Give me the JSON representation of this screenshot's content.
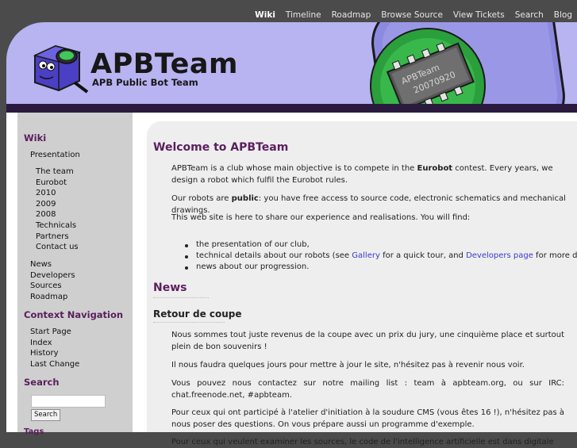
{
  "topnav": {
    "items": [
      "Wiki",
      "Timeline",
      "Roadmap",
      "Browse Source",
      "View Tickets",
      "Search",
      "Blog"
    ]
  },
  "header": {
    "title": "APBTeam",
    "subtitle": "APB Public Bot Team",
    "chip_text_line1": "APBTeam",
    "chip_text_line2": "20070920"
  },
  "sidebar": {
    "wiki_heading": "Wiki",
    "presentation": "Presentation",
    "presentation_sub": [
      "The team",
      "Eurobot",
      "2010",
      "2009",
      "2008",
      "Technicals",
      "Partners",
      "Contact us"
    ],
    "other_items": [
      "News",
      "Developers",
      "Sources",
      "Roadmap"
    ],
    "context_heading": "Context Navigation",
    "context_items": [
      "Start Page",
      "Index",
      "History",
      "Last Change"
    ],
    "search_heading": "Search",
    "search_button": "Search",
    "cut_heading": "Tags"
  },
  "content": {
    "welcome_title": "Welcome to APBTeam",
    "intro_pre": "APBTeam is a club whose main objective is to compete in the ",
    "intro_bold": "Eurobot",
    "intro_post": " contest. Every years, we design a robot which fulfil the Eurobot rules.",
    "public_pre": "Our robots are ",
    "public_bold": "public",
    "public_post": ": you have free access to source code, electronic schematics and mechanical drawings.",
    "share": "This web site is here to share our experience and realisations. You will find:",
    "bullet1": "the presentation of our club,",
    "bullet2_pre": "technical details about our robots (see ",
    "bullet2_link1": "Gallery",
    "bullet2_mid": " for a quick tour, and ",
    "bullet2_link2": "Developers page",
    "bullet2_post": " for more details),",
    "bullet3": "news about our progression.",
    "news_title": "News",
    "post_title": "Retour de coupe",
    "para1": "Nous sommes tout juste revenus de la coupe avec un prix du jury, une cinquième place et surtout plein de bon souvenirs !",
    "para2": "Il nous faudra quelques jours pour mettre à jour le site, n'hésitez pas à revenir nous voir.",
    "para3": "Vous pouvez nous contactez sur notre mailing list : team à apbteam.org, ou sur IRC: chat.freenode.net, #apbteam.",
    "para4": "Pour ceux qui ont participé à l'atelier d'initiation à la soudure CMS (vous êtes 16 !), n'hésitez pas à nous poser des questions. On vous prépare aussi un programme d'exemple.",
    "para5": "Pour ceux qui veulent examiner les sources, le code de l'intelligence artificielle est dans digitale"
  },
  "colors": {
    "banner": "#b7b4f1",
    "heading": "#5b1f5e",
    "link": "#3a3acf",
    "sidebar": "#cfcfcf"
  }
}
